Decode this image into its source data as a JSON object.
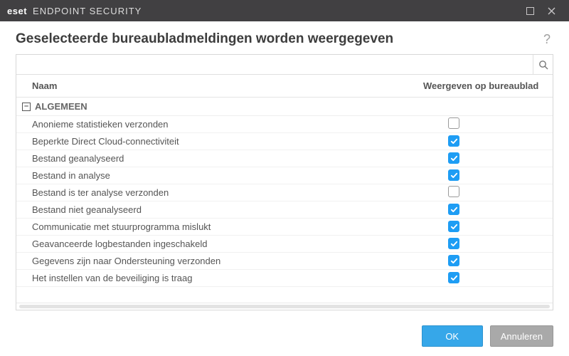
{
  "titlebar": {
    "brand_bold": "eset",
    "brand_product": "ENDPOINT SECURITY"
  },
  "header": {
    "title": "Geselecteerde bureaubladmeldingen worden weergegeven"
  },
  "search": {
    "placeholder": ""
  },
  "columns": {
    "name": "Naam",
    "show": "Weergeven op bureaublad"
  },
  "group": {
    "label": "ALGEMEEN",
    "collapse_glyph": "–"
  },
  "rows": [
    {
      "label": "Anonieme statistieken verzonden",
      "checked": false
    },
    {
      "label": "Beperkte Direct Cloud-connectiviteit",
      "checked": true
    },
    {
      "label": "Bestand geanalyseerd",
      "checked": true
    },
    {
      "label": "Bestand in analyse",
      "checked": true
    },
    {
      "label": "Bestand is ter analyse verzonden",
      "checked": false
    },
    {
      "label": "Bestand niet geanalyseerd",
      "checked": true
    },
    {
      "label": "Communicatie met stuurprogramma mislukt",
      "checked": true
    },
    {
      "label": "Geavanceerde logbestanden ingeschakeld",
      "checked": true
    },
    {
      "label": "Gegevens zijn naar Ondersteuning verzonden",
      "checked": true
    },
    {
      "label": "Het instellen van de beveiliging is traag",
      "checked": true
    }
  ],
  "footer": {
    "ok": "OK",
    "cancel": "Annuleren"
  }
}
